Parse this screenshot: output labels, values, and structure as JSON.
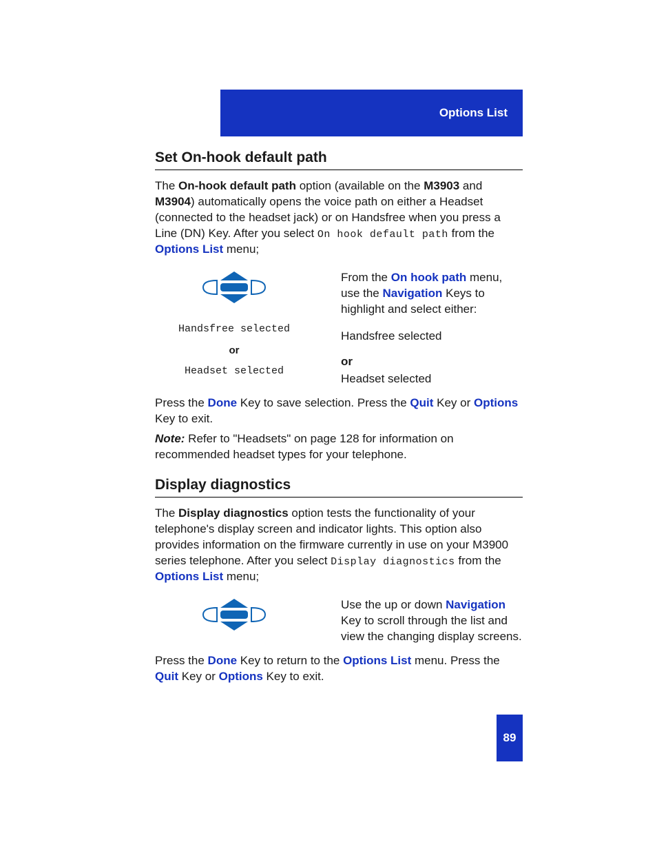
{
  "header": {
    "title": "Options List"
  },
  "section1": {
    "heading": "Set On-hook default path",
    "p1a": "The ",
    "bold1": "On-hook default path",
    "p1b": " option (available on the ",
    "bold2": "M3903",
    "p1c": " and ",
    "bold3": "M3904",
    "p1d": ") automatically opens the voice path on either a Headset (connected to the headset jack) or on Handsfree when you press a Line (DN) Key. After you select ",
    "mono1": "On hook default path",
    "p1e": " from the ",
    "key1": "Options List",
    "p1f": " menu;",
    "left": {
      "display1": "Handsfree selected",
      "or": "or",
      "display2": "Headset selected"
    },
    "right": {
      "r1a": "From the ",
      "r1key1": "On hook path",
      "r1b": " menu, use the ",
      "r1key2": "Navigation",
      "r1c": " Keys to highlight and select either:",
      "r2": "Handsfree selected",
      "r3": "or",
      "r4": "Headset selected"
    },
    "p2a": "Press the ",
    "p2key1": "Done",
    "p2b": " Key to save selection. Press the ",
    "p2key2": "Quit",
    "p2c": " Key or ",
    "p2key3": "Options",
    "p2d": " Key to exit.",
    "note_label": "Note:",
    "note_text": " Refer to \"Headsets\" on page 128 for information on recommended headset types for your telephone."
  },
  "section2": {
    "heading": "Display diagnostics",
    "p1a": "The ",
    "bold1": "Display diagnostics",
    "p1b": " option tests the functionality of your telephone's display screen and indicator lights. This option also provides information on the firmware currently in use on your M3900 series telephone. After you select ",
    "mono1": "Display diagnostics",
    "p1c": " from the ",
    "key1": "Options List",
    "p1d": " menu;",
    "right": {
      "r1a": "Use the up or down ",
      "r1key1": "Navigation",
      "r1b": " Key to scroll through the list and view the changing display screens."
    },
    "p2a": "Press the ",
    "p2key1": "Done",
    "p2b": " Key to return to the ",
    "p2key2": "Options List",
    "p2c": " menu. Press the ",
    "p2key3": "Quit",
    "p2d": " Key or ",
    "p2key4": "Options",
    "p2e": " Key to exit."
  },
  "page_number": "89"
}
